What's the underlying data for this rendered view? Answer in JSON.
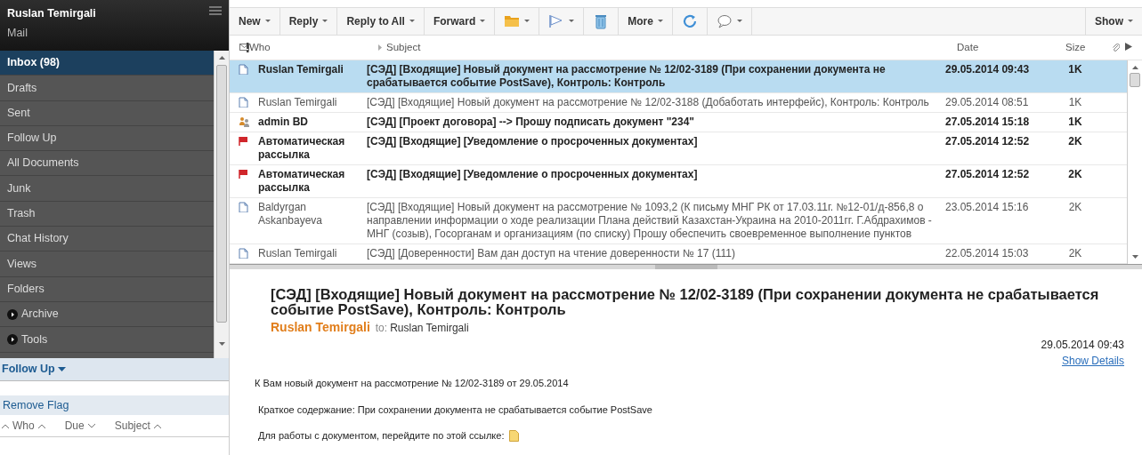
{
  "sidebar": {
    "user": "Ruslan Temirgali",
    "app": "Mail",
    "items": [
      {
        "label": "Inbox (98)",
        "kind": "folder",
        "selected": true
      },
      {
        "label": "Drafts",
        "kind": "folder",
        "selected": false
      },
      {
        "label": "Sent",
        "kind": "folder",
        "selected": false
      },
      {
        "label": "Follow Up",
        "kind": "folder",
        "selected": false
      },
      {
        "label": "All Documents",
        "kind": "folder",
        "selected": false
      },
      {
        "label": "Junk",
        "kind": "folder",
        "selected": false
      },
      {
        "label": "Trash",
        "kind": "folder",
        "selected": false
      },
      {
        "label": "Chat History",
        "kind": "folder",
        "selected": false
      },
      {
        "label": "Views",
        "kind": "folder",
        "selected": false
      },
      {
        "label": "Folders",
        "kind": "folder",
        "selected": false
      },
      {
        "label": "Archive",
        "kind": "expandable",
        "selected": false
      },
      {
        "label": "Tools",
        "kind": "expandable",
        "selected": false
      }
    ]
  },
  "follow_up": {
    "title": "Follow Up",
    "action": "Remove Flag",
    "columns": [
      {
        "label": "Who",
        "descending": false
      },
      {
        "label": "Due",
        "descending": true
      },
      {
        "label": "Subject",
        "descending": false
      }
    ]
  },
  "toolbar": {
    "buttons": [
      {
        "kind": "text",
        "label": "New",
        "menu": true
      },
      {
        "kind": "text",
        "label": "Reply",
        "menu": true
      },
      {
        "kind": "text",
        "label": "Reply to All",
        "menu": true
      },
      {
        "kind": "text",
        "label": "Forward",
        "menu": true
      },
      {
        "kind": "folder",
        "menu": true
      },
      {
        "kind": "flag",
        "menu": true
      },
      {
        "kind": "trash",
        "menu": false
      },
      {
        "kind": "text",
        "label": "More",
        "menu": true
      },
      {
        "kind": "refresh",
        "menu": false
      },
      {
        "kind": "chat",
        "menu": true
      }
    ],
    "show": {
      "label": "Show",
      "menu": true
    }
  },
  "message_list": {
    "columns": {
      "who": "Who",
      "subject": "Subject",
      "date": "Date",
      "size": "Size"
    },
    "rows": [
      {
        "kind": "document",
        "who": "Ruslan Temirgali",
        "subject": "[СЭД] [Входящие] Новый документ на рассмотрение № 12/02-3189 (При сохранении документа не срабатывается событие PostSave), Контроль: Контроль",
        "date": "29.05.2014 09:43",
        "size": "1K",
        "unread": true,
        "selected": true
      },
      {
        "kind": "document",
        "who": "Ruslan Temirgali",
        "subject": "[СЭД] [Входящие] Новый документ на рассмотрение № 12/02-3188 (Добаботать интерфейс), Контроль: Контроль",
        "date": "29.05.2014 08:51",
        "size": "1K",
        "unread": false,
        "selected": false
      },
      {
        "kind": "group",
        "who": "admin BD",
        "subject": "[СЭД] [Проект договора] --> Прошу подписать документ \"234\"",
        "date": "27.05.2014 15:18",
        "size": "1K",
        "unread": true,
        "selected": false
      },
      {
        "kind": "flag",
        "who": "Автоматическая рассылка",
        "subject": "[СЭД] [Входящие] [Уведомление о просроченных документах]",
        "date": "27.05.2014 12:52",
        "size": "2K",
        "unread": true,
        "selected": false
      },
      {
        "kind": "flag",
        "who": "Автоматическая рассылка",
        "subject": "[СЭД] [Входящие] [Уведомление о просроченных документах]",
        "date": "27.05.2014 12:52",
        "size": "2K",
        "unread": true,
        "selected": false
      },
      {
        "kind": "document",
        "who": "Baldyrgan Askanbayeva",
        "subject": "[СЭД] [Входящие] Новый документ на рассмотрение № 1093,2 (К письму МНГ РК от 17.03.11г. №12-01/д-856,8 о направлении информации о ходе реализации Плана действий Казахстан-Украина на 2010-2011гг. Г.Абдрахимов - МНГ (созыв), Госорганам и организациям (по списку) Прошу обеспечить своевременное выполнение пунктов",
        "date": "23.05.2014 15:16",
        "size": "2K",
        "unread": false,
        "selected": false
      },
      {
        "kind": "document",
        "who": "Ruslan Temirgali",
        "subject": "[СЭД] [Доверенности] Вам дан доступ на чтение доверенности № 17 (111)",
        "date": "22.05.2014 15:03",
        "size": "2K",
        "unread": false,
        "selected": false
      }
    ]
  },
  "preview": {
    "subject": "[СЭД] [Входящие] Новый документ на рассмотрение № 12/02-3189 (При сохранении документа не срабатывается событие PostSave), Контроль: Контроль",
    "from": "Ruslan Temirgali",
    "to_label": "to:",
    "to": "Ruslan Temirgali",
    "date": "29.05.2014 09:43",
    "details_link": "Show Details",
    "body": [
      "К Вам новый документ на рассмотрение № 12/02-3189 от 29.05.2014",
      "Краткое содержание: При сохранении документа не срабатывается событие PostSave"
    ],
    "link_line": "Для работы с документом, перейдите по этой ссылке:"
  }
}
